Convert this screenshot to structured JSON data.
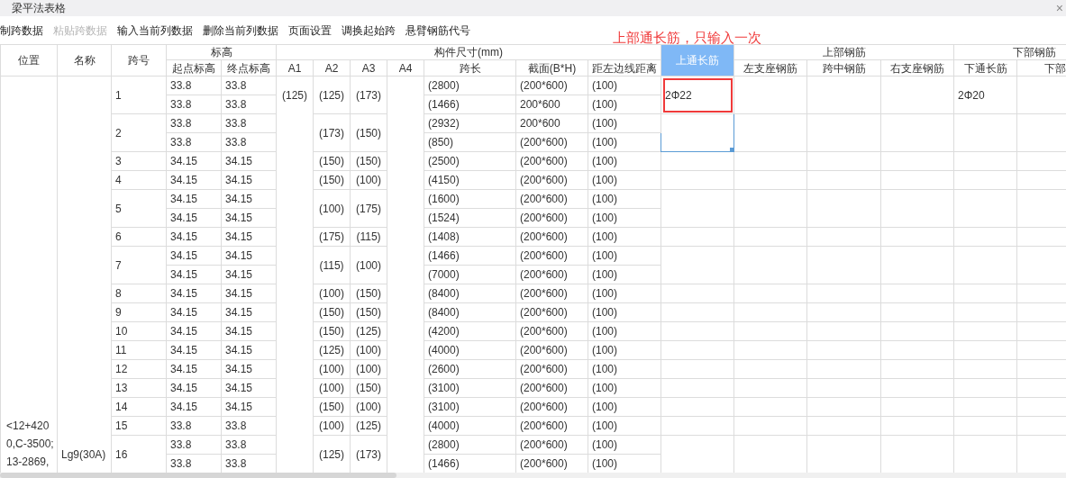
{
  "window": {
    "title": "梁平法表格",
    "close": "×"
  },
  "toolbar": [
    {
      "label": "制跨数据",
      "disabled": false
    },
    {
      "label": "粘贴跨数据",
      "disabled": true
    },
    {
      "label": "输入当前列数据",
      "disabled": false
    },
    {
      "label": "删除当前列数据",
      "disabled": false
    },
    {
      "label": "页面设置",
      "disabled": false
    },
    {
      "label": "调换起始跨",
      "disabled": false
    },
    {
      "label": "悬臂钢筋代号",
      "disabled": false
    }
  ],
  "annotation": "上部通长筋，只输入一次",
  "table": {
    "headers": [
      {
        "label": "位置",
        "selected": false
      },
      {
        "label": "名称",
        "selected": false
      },
      {
        "label": "跨号",
        "selected": false
      },
      {
        "label": "标高",
        "children": [
          {
            "label": "起点标高",
            "selected": false
          },
          {
            "label": "终点标高",
            "selected": false
          }
        ]
      },
      {
        "label": "构件尺寸(mm)",
        "children": [
          {
            "label": "A1",
            "selected": false
          },
          {
            "label": "A2",
            "selected": false
          },
          {
            "label": "A3",
            "selected": false
          },
          {
            "label": "A4",
            "selected": false
          },
          {
            "label": "跨长",
            "selected": false
          },
          {
            "label": "截面(B*H)",
            "selected": false
          },
          {
            "label": "距左边线距离",
            "selected": false
          }
        ]
      },
      {
        "label": "上通长筋",
        "selected": true
      },
      {
        "label": "上部钢筋",
        "children": [
          {
            "label": "左支座钢筋",
            "selected": false
          },
          {
            "label": "跨中钢筋",
            "selected": false
          },
          {
            "label": "右支座钢筋",
            "selected": false
          }
        ]
      },
      {
        "label": "下部钢筋",
        "children": [
          {
            "label": "下通长筋",
            "selected": false
          },
          {
            "label": "下部",
            "selected": false
          }
        ]
      }
    ],
    "position": [
      "<12+420",
      "0,C-3500;",
      "13-2869,"
    ],
    "name": "Lg9(30A)",
    "spans": [
      {
        "no": "1",
        "a1": "(125)",
        "a2": "(125)",
        "a3": "(173)",
        "top_bar": "2Φ22",
        "top_bar_boxed": true,
        "top_bar_selected": false,
        "bottom_bar": "2Φ20",
        "rows": [
          {
            "start": "33.8",
            "end": "33.8",
            "length": "(2800)",
            "section": "(200*600)",
            "offset": "(100)"
          },
          {
            "start": "33.8",
            "end": "33.8",
            "length": "(1466)",
            "section": "200*600",
            "offset": "(100)"
          }
        ]
      },
      {
        "no": "2",
        "a2": "(173)",
        "a3": "(150)",
        "top_bar_boxed": false,
        "top_bar_selected": true,
        "rows": [
          {
            "start": "33.8",
            "end": "33.8",
            "length": "(2932)",
            "section": "200*600",
            "offset": "(100)"
          },
          {
            "start": "33.8",
            "end": "33.8",
            "length": "(850)",
            "section": "(200*600)",
            "offset": "(100)"
          }
        ]
      },
      {
        "no": "3",
        "a2": "(150)",
        "a3": "(150)",
        "top_bar_boxed": false,
        "top_bar_selected": false,
        "rows": [
          {
            "start": "34.15",
            "end": "34.15",
            "length": "(2500)",
            "section": "(200*600)",
            "offset": "(100)"
          }
        ]
      },
      {
        "no": "4",
        "a2": "(150)",
        "a3": "(100)",
        "top_bar_boxed": false,
        "top_bar_selected": false,
        "rows": [
          {
            "start": "34.15",
            "end": "34.15",
            "length": "(4150)",
            "section": "(200*600)",
            "offset": "(100)"
          }
        ]
      },
      {
        "no": "5",
        "a2": "(100)",
        "a3": "(175)",
        "top_bar_boxed": false,
        "top_bar_selected": false,
        "rows": [
          {
            "start": "34.15",
            "end": "34.15",
            "length": "(1600)",
            "section": "(200*600)",
            "offset": "(100)"
          },
          {
            "start": "34.15",
            "end": "34.15",
            "length": "(1524)",
            "section": "(200*600)",
            "offset": "(100)"
          }
        ]
      },
      {
        "no": "6",
        "a2": "(175)",
        "a3": "(115)",
        "top_bar_boxed": false,
        "top_bar_selected": false,
        "rows": [
          {
            "start": "34.15",
            "end": "34.15",
            "length": "(1408)",
            "section": "(200*600)",
            "offset": "(100)"
          }
        ]
      },
      {
        "no": "7",
        "a2": "(115)",
        "a3": "(100)",
        "top_bar_boxed": false,
        "top_bar_selected": false,
        "rows": [
          {
            "start": "34.15",
            "end": "34.15",
            "length": "(1466)",
            "section": "(200*600)",
            "offset": "(100)"
          },
          {
            "start": "34.15",
            "end": "34.15",
            "length": "(7000)",
            "section": "(200*600)",
            "offset": "(100)"
          }
        ]
      },
      {
        "no": "8",
        "a2": "(100)",
        "a3": "(150)",
        "top_bar_boxed": false,
        "top_bar_selected": false,
        "rows": [
          {
            "start": "34.15",
            "end": "34.15",
            "length": "(8400)",
            "section": "(200*600)",
            "offset": "(100)"
          }
        ]
      },
      {
        "no": "9",
        "a2": "(150)",
        "a3": "(150)",
        "top_bar_boxed": false,
        "top_bar_selected": false,
        "rows": [
          {
            "start": "34.15",
            "end": "34.15",
            "length": "(8400)",
            "section": "(200*600)",
            "offset": "(100)"
          }
        ]
      },
      {
        "no": "10",
        "a2": "(150)",
        "a3": "(125)",
        "top_bar_boxed": false,
        "top_bar_selected": false,
        "rows": [
          {
            "start": "34.15",
            "end": "34.15",
            "length": "(4200)",
            "section": "(200*600)",
            "offset": "(100)"
          }
        ]
      },
      {
        "no": "11",
        "a2": "(125)",
        "a3": "(100)",
        "top_bar_boxed": false,
        "top_bar_selected": false,
        "rows": [
          {
            "start": "34.15",
            "end": "34.15",
            "length": "(4000)",
            "section": "(200*600)",
            "offset": "(100)"
          }
        ]
      },
      {
        "no": "12",
        "a2": "(100)",
        "a3": "(100)",
        "top_bar_boxed": false,
        "top_bar_selected": false,
        "rows": [
          {
            "start": "34.15",
            "end": "34.15",
            "length": "(2600)",
            "section": "(200*600)",
            "offset": "(100)"
          }
        ]
      },
      {
        "no": "13",
        "a2": "(100)",
        "a3": "(150)",
        "top_bar_boxed": false,
        "top_bar_selected": false,
        "rows": [
          {
            "start": "34.15",
            "end": "34.15",
            "length": "(3100)",
            "section": "(200*600)",
            "offset": "(100)"
          }
        ]
      },
      {
        "no": "14",
        "a2": "(150)",
        "a3": "(100)",
        "top_bar_boxed": false,
        "top_bar_selected": false,
        "rows": [
          {
            "start": "34.15",
            "end": "34.15",
            "length": "(3100)",
            "section": "(200*600)",
            "offset": "(100)"
          }
        ]
      },
      {
        "no": "15",
        "a2": "(100)",
        "a3": "(125)",
        "top_bar_boxed": false,
        "top_bar_selected": false,
        "rows": [
          {
            "start": "33.8",
            "end": "33.8",
            "length": "(4000)",
            "section": "(200*600)",
            "offset": "(100)"
          }
        ]
      },
      {
        "no": "16",
        "a2": "(125)",
        "a3": "(173)",
        "top_bar_boxed": false,
        "top_bar_selected": false,
        "rows": [
          {
            "start": "33.8",
            "end": "33.8",
            "length": "(2800)",
            "section": "(200*600)",
            "offset": "(100)"
          },
          {
            "start": "33.8",
            "end": "33.8",
            "length": "(1466)",
            "section": "(200*600)",
            "offset": "(100)"
          }
        ]
      }
    ]
  }
}
